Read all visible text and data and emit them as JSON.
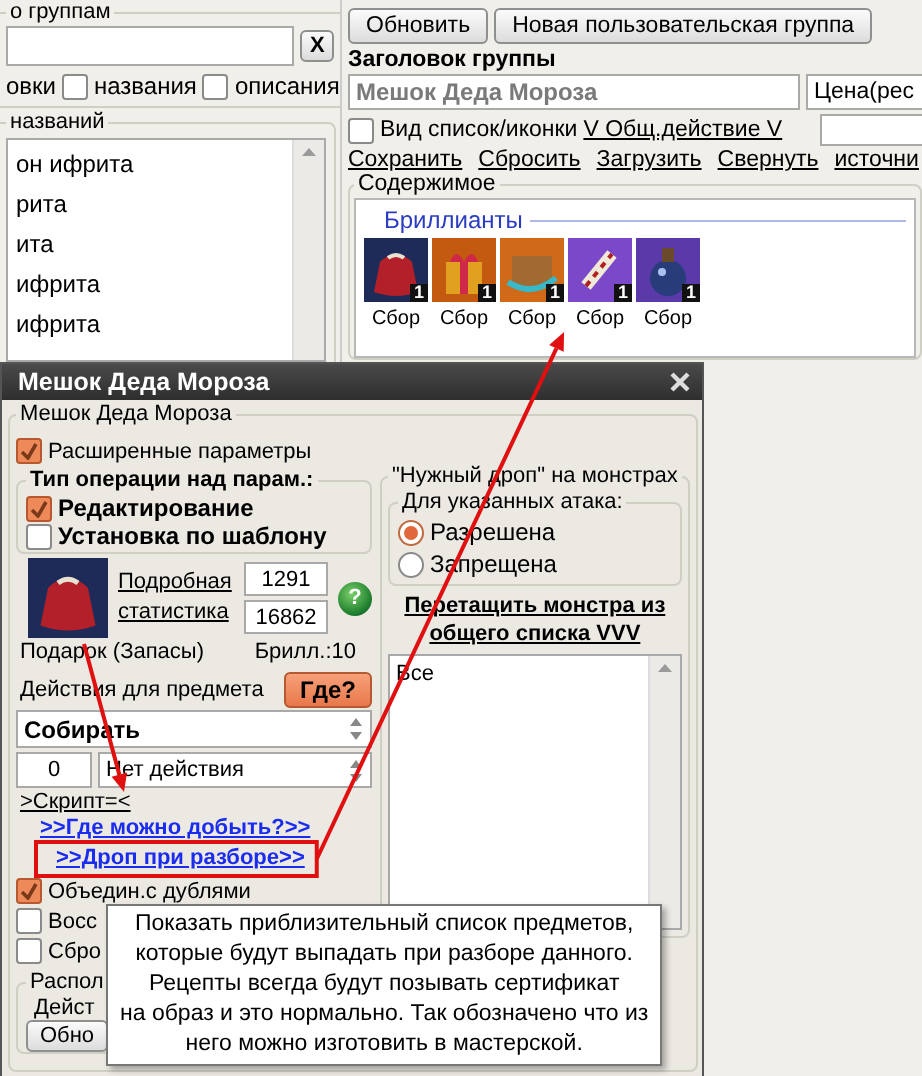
{
  "left_panel": {
    "group_legend": "о группам",
    "clear_button": "X",
    "filter_prefix": "овки",
    "filters": [
      {
        "label": "названия",
        "checked": false
      },
      {
        "label": "описания",
        "checked": false
      }
    ],
    "list_legend": "названий",
    "items": [
      "он ифрита",
      "рита",
      "ита",
      "ифрита",
      "ифрита"
    ]
  },
  "toolbar": {
    "buttons": [
      "Обновить",
      "Новая пользовательская группа"
    ]
  },
  "group_header": {
    "label": "Заголовок группы",
    "title_value": "Мешок Деда Мороза",
    "price_value": "Цена(рес"
  },
  "view_toggle": {
    "label": "Вид список/иконки",
    "checked": false
  },
  "general_action_link": "V Общ.действие V",
  "links": [
    "Сохранить",
    "Сбросить",
    "Загрузить",
    "Свернуть",
    "источни"
  ],
  "contents": {
    "legend": "Содержимое",
    "category": "Бриллианты",
    "items": [
      {
        "kind": "sack",
        "badge": "1",
        "caption": "Сбор"
      },
      {
        "kind": "gift",
        "badge": "1",
        "caption": "Сбор"
      },
      {
        "kind": "chest",
        "badge": "1",
        "caption": "Сбор"
      },
      {
        "kind": "scroll",
        "badge": "1",
        "caption": "Сбор"
      },
      {
        "kind": "potion",
        "badge": "1",
        "caption": "Сбор"
      }
    ]
  },
  "dialog": {
    "title": "Мешок Деда Мороза",
    "legend": "Мешок Деда Мороза",
    "advanced": {
      "label": "Расширенные параметры",
      "checked": true
    },
    "operation_group": {
      "legend": "Тип операции над парам.:",
      "options": [
        {
          "label": "Редактирование",
          "checked": true
        },
        {
          "label": "Установка по шаблону",
          "checked": false
        }
      ]
    },
    "item": {
      "stats_link": "Подробная статистика",
      "stat_values": [
        "1291",
        "16862"
      ],
      "help_button": "?",
      "name": "Подарок (Запасы)",
      "diamonds": "Брилл.:10"
    },
    "actions_label": "Действия для предмета",
    "where_button": "Где?",
    "action_select": "Собирать",
    "count_value": "0",
    "secondary_select": "Нет действия",
    "script_link": ">Скрипт=<",
    "where_link": ">>Где можно добыть?>>",
    "drop_link": ">>Дроп при разборе>>",
    "checks": [
      {
        "label": "Объедин.с дублями",
        "checked": true
      },
      {
        "label": "Восс",
        "checked": false
      },
      {
        "label": "Сбро",
        "checked": false
      }
    ],
    "placement": {
      "legend": "Распол",
      "label": "Дейст",
      "button": "Обно"
    },
    "monster_drop": {
      "legend": "\"Нужный дроп\" на монстрах",
      "attack_legend": "Для указанных атака:",
      "options": [
        {
          "label": "Разрешена",
          "selected": true
        },
        {
          "label": "Запрещена",
          "selected": false
        }
      ],
      "drag_hint": "Перетащить монстра из общего списка VVV",
      "list_items": [
        "Все"
      ]
    }
  },
  "tooltip": {
    "text": "Показать приблизительный список предметов,\nкоторые будут выпадать при разборе данного.\nРецепты всегда будут позывать сертификат\nна образ и это нормально. Так обозначено что из\nнего можно изготовить в мастерской."
  }
}
